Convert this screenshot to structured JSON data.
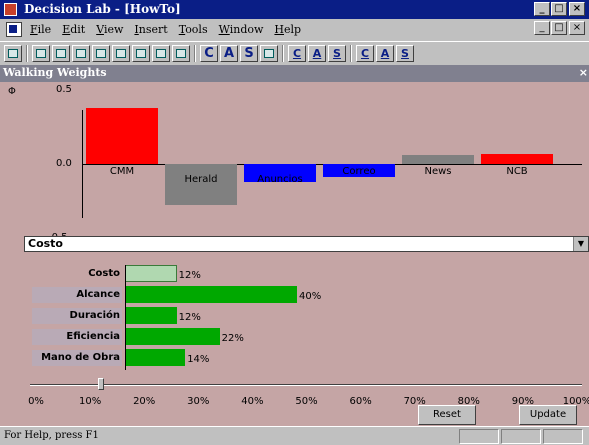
{
  "window": {
    "title": "Decision Lab - [HowTo]",
    "buttons": [
      "_",
      "□",
      "×"
    ]
  },
  "menu": {
    "items": [
      "File",
      "Edit",
      "View",
      "Insert",
      "Tools",
      "Window",
      "Help"
    ],
    "buttons": [
      "_",
      "□",
      "×"
    ]
  },
  "toolbar": {
    "icons": [
      "view-icon",
      "grid-icon",
      "chart-icon",
      "table-icon",
      "list-icon",
      "matrix-icon",
      "report-icon",
      "sheet-icon"
    ],
    "letters": [
      "C",
      "A",
      "S"
    ],
    "underlined": [
      "C",
      "A",
      "S"
    ],
    "extra": [
      "window-icon",
      "C",
      "A",
      "S"
    ]
  },
  "child": {
    "title": "Walking Weights",
    "close": "×"
  },
  "phi_symbol": "Φ",
  "chart_data": {
    "type": "bar",
    "categories": [
      "CMM",
      "Herald",
      "Anuncios",
      "Correo",
      "News",
      "NCB"
    ],
    "values": [
      0.38,
      -0.28,
      -0.12,
      -0.09,
      0.06,
      0.07
    ],
    "colors": [
      "#ff0000",
      "#808080",
      "#0000ff",
      "#0000ff",
      "#808080",
      "#ff0000"
    ],
    "ytick_labels": [
      "0.5",
      "0.0",
      "-0.5"
    ],
    "ylim": [
      -0.5,
      0.5
    ],
    "xlabel": "",
    "ylabel": ""
  },
  "criterion_select": {
    "value": "Costo",
    "arrow": "▼"
  },
  "weights": {
    "criteria": [
      {
        "label": "Costo",
        "value": 12,
        "pct": "12%",
        "color": "#b0d8b0",
        "selected": true
      },
      {
        "label": "Alcance",
        "value": 40,
        "pct": "40%",
        "color": "#00a800",
        "selected": false
      },
      {
        "label": "Duración",
        "value": 12,
        "pct": "12%",
        "color": "#00a800",
        "selected": false
      },
      {
        "label": "Eficiencia",
        "value": 22,
        "pct": "22%",
        "color": "#00a800",
        "selected": false
      },
      {
        "label": "Mano de Obra",
        "value": 14,
        "pct": "14%",
        "color": "#00a800",
        "selected": false
      }
    ]
  },
  "slider": {
    "value": 12,
    "ticks": [
      "0%",
      "10%",
      "20%",
      "30%",
      "40%",
      "50%",
      "60%",
      "70%",
      "80%",
      "90%",
      "100%"
    ]
  },
  "actions": {
    "reset": "Reset",
    "update": "Update"
  },
  "status": {
    "message": "For Help, press F1"
  }
}
